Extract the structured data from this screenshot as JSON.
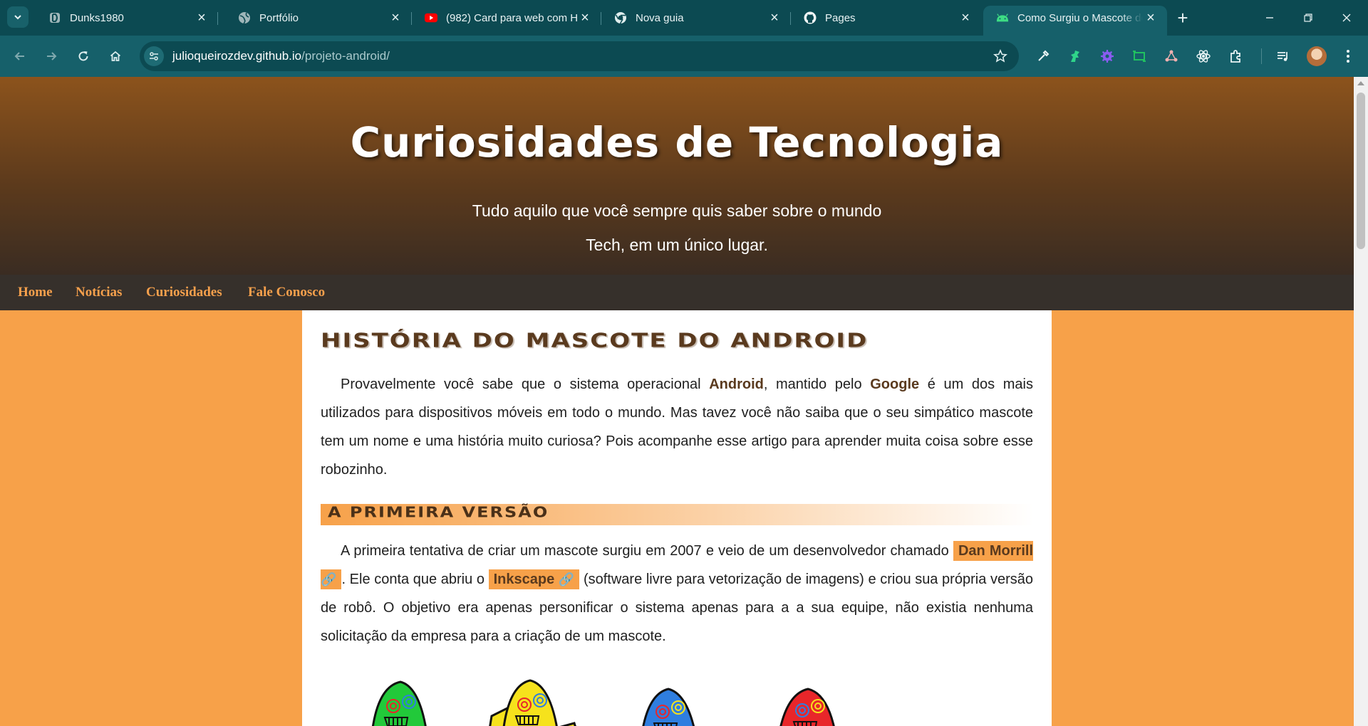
{
  "browser": {
    "tabs": [
      {
        "title": "Dunks1980",
        "icon": "dunks-icon"
      },
      {
        "title": "Portfólio",
        "icon": "globe-icon"
      },
      {
        "title": "(982) Card para web com H",
        "icon": "youtube-icon"
      },
      {
        "title": "Nova guia",
        "icon": "chrome-icon"
      },
      {
        "title": "Pages",
        "icon": "github-icon"
      },
      {
        "title": "Como Surgiu o Mascote do",
        "icon": "android-icon",
        "active": true
      }
    ],
    "url_host": "julioqueirozdev.github.io",
    "url_path": "/projeto-android/"
  },
  "header": {
    "title": "Curiosidades de Tecnologia",
    "subtitle_line1": "Tudo aquilo que você sempre quis saber sobre o mundo",
    "subtitle_line2": "Tech, em um único lugar."
  },
  "nav": [
    "Home",
    "Notícias",
    "Curiosidades",
    "Fale Conosco"
  ],
  "article": {
    "title": "História do Mascote do Android",
    "intro": {
      "t1": "Provavelmente você sabe que o sistema operacional ",
      "b1": "Android",
      "t2": ", mantido pelo ",
      "b2": "Google",
      "t3": " é um dos mais utilizados para dispositivos móveis em todo o mundo. Mas tavez você não saiba que o seu simpático mascote tem um nome e uma história muito curiosa? Pois acompanhe esse artigo para aprender muita coisa sobre esse robozinho."
    },
    "section1_title": "A Primeira Versão",
    "section1": {
      "t1": "A primeira tentativa de criar um mascote surgiu em 2007 e veio de um desenvolvedor chamado ",
      "link1": "Dan Morrill",
      "t2": ". Ele conta que abriu o ",
      "link2": "Inkscape",
      "t3": " (software livre para vetorização de imagens) e criou sua própria versão de robô. O objetivo era apenas personificar o sistema apenas para a a sua equipe, não existia nenhuma solicitação da empresa para a criação de um mascote."
    },
    "mascot_colors": [
      "#22c93a",
      "#f6e21c",
      "#2f7ee0",
      "#e8262a"
    ]
  }
}
